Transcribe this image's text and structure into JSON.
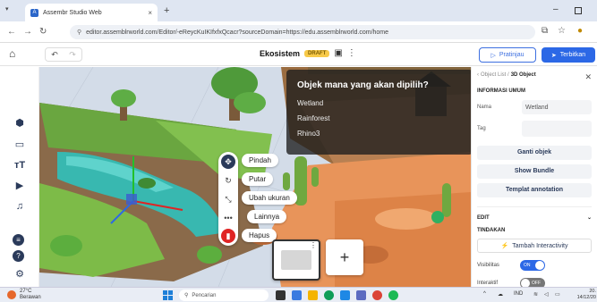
{
  "browser": {
    "tab_title": "Assembr Studio Web",
    "tab_close": "×",
    "new_tab": "+",
    "url": "editor.assemblrworld.com/Editor/-eReycKuIKIfxfxQcacr?sourceDomain=https://edu.assemblrworld.com/home",
    "minimize": "–"
  },
  "header": {
    "project_title": "Ekosistem",
    "draft_badge": "DRAFT",
    "preview_label": "Pratinjau",
    "publish_label": "Terbitkan"
  },
  "quiz": {
    "question": "Objek mana yang akan dipilih?",
    "options": [
      "Wetland",
      "Rainforest",
      "Rhino3"
    ]
  },
  "context_menu": {
    "move": "Pindah",
    "rotate": "Putar",
    "resize": "Ubah ukuran",
    "more": "Lainnya",
    "delete": "Hapus"
  },
  "tray": {
    "add_label": "+"
  },
  "right_panel": {
    "breadcrumb_parent": "Object List /",
    "breadcrumb_current": "3D Object",
    "general_info_title": "INFORMASI UMUM",
    "name_label": "Nama",
    "name_value": "Wetland",
    "tag_label": "Tag",
    "change_object": "Ganti objek",
    "show_bundle": "Show Bundle",
    "annotation_template": "Templat annotation",
    "edit_title": "EDIT",
    "action_title": "TINDAKAN",
    "add_interactivity": "Tambah Interactivity",
    "visibility_label": "Visibilitas",
    "visibility_state": "ON",
    "interactive_label": "Interaktif",
    "interactive_state": "OFF"
  },
  "taskbar": {
    "temperature": "27°C",
    "weather_desc": "Berawan",
    "search_placeholder": "Pencarian",
    "lang": "IND",
    "time": "20.",
    "date": "14/12/20"
  },
  "colors": {
    "accent": "#2c68e6",
    "danger": "#e02424",
    "draft": "#f7c948",
    "water": "#38b8b0",
    "sand": "#e8945a"
  }
}
